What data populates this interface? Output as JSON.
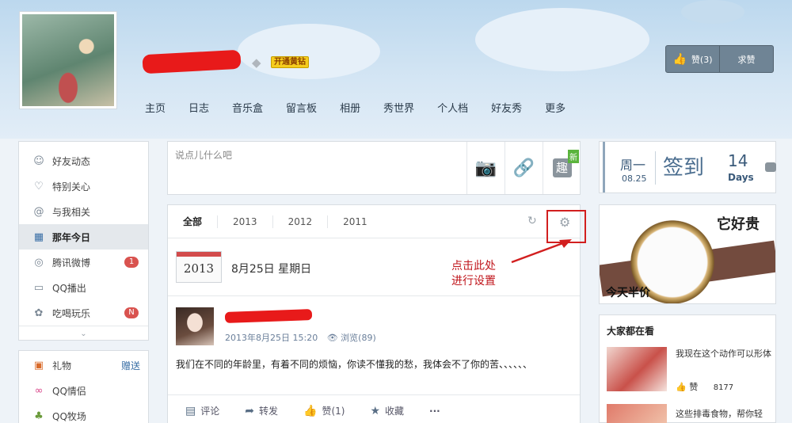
{
  "header": {
    "vip_label": "开通黄钻",
    "nav": [
      "主页",
      "日志",
      "音乐盒",
      "留言板",
      "相册",
      "秀世界",
      "个人档",
      "好友秀",
      "更多"
    ],
    "like_button": "赞(3)",
    "ask_like_button": "求赞"
  },
  "sidebar": {
    "items": [
      {
        "label": "好友动态",
        "icon": "user-icon"
      },
      {
        "label": "特别关心",
        "icon": "heart-icon"
      },
      {
        "label": "与我相关",
        "icon": "at-icon"
      },
      {
        "label": "那年今日",
        "icon": "calendar-icon",
        "active": true
      },
      {
        "label": "腾讯微博",
        "icon": "weibo-icon",
        "badge": "1"
      },
      {
        "label": "QQ播出",
        "icon": "tv-icon"
      },
      {
        "label": "吃喝玩乐",
        "icon": "food-icon",
        "badge": "N"
      }
    ],
    "apps": [
      {
        "label": "礼物",
        "action": "赠送"
      },
      {
        "label": "QQ情侣"
      },
      {
        "label": "QQ牧场"
      }
    ]
  },
  "composer": {
    "placeholder": "说点儿什么吧",
    "new_badge": "新",
    "fun_label": "趣"
  },
  "feed": {
    "tabs": [
      "全部",
      "2013",
      "2012",
      "2011"
    ],
    "calendar_year": "2013",
    "date_text": "8月25日 星期日",
    "annotation": [
      "点击此处",
      "进行设置"
    ],
    "post": {
      "time": "2013年8月25日 15:20",
      "views": "浏览(89)",
      "text": "我们在不同的年龄里，有着不同的烦恼，你读不懂我的愁，我体会不了你的苦、、、、、、",
      "actions": [
        "评论",
        "转发",
        "赞(1)",
        "收藏",
        "···"
      ]
    }
  },
  "sign": {
    "weekday": "周一",
    "date": "08.25",
    "label": "签到",
    "days_num": "14",
    "days_word": "Days"
  },
  "ad": {
    "headline": "它好贵",
    "caption": "今天半价"
  },
  "trending": {
    "title": "大家都在看",
    "items": [
      {
        "text": "我现在这个动作可以形体",
        "likes_label": "赞",
        "likes": "8177"
      },
      {
        "text": "这些排毒食物，帮你轻"
      }
    ]
  }
}
